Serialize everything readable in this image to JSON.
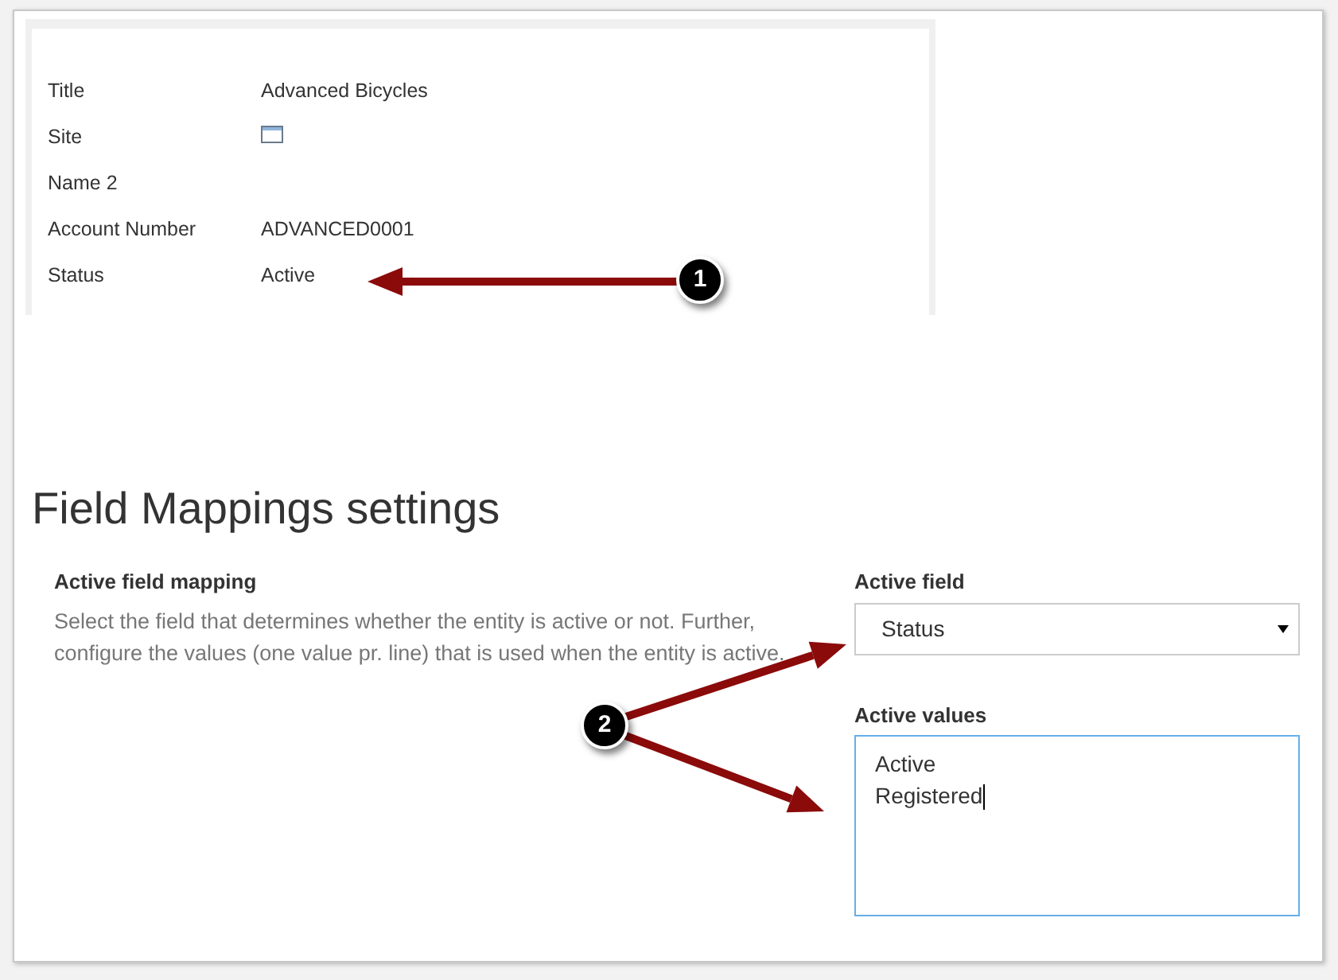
{
  "record": {
    "fields": [
      {
        "label": "Title",
        "kind": "text",
        "value": "Advanced Bicycles"
      },
      {
        "label": "Site",
        "kind": "icon"
      },
      {
        "label": "Name 2",
        "kind": "text"
      },
      {
        "label": "Account Number",
        "kind": "text",
        "value": "ADVANCED0001"
      },
      {
        "label": "Status",
        "kind": "text",
        "value": "Active"
      }
    ]
  },
  "settings": {
    "heading": "Field Mappings settings",
    "section_title": "Active field mapping",
    "description": "Select the field that determines whether the entity is active or not. Further, configure the values (one value pr. line) that is used when the entity is active.",
    "active_field": {
      "label": "Active field",
      "value": "Status"
    },
    "active_values": {
      "label": "Active values",
      "lines": [
        "Active",
        "Registered"
      ],
      "focused": true
    }
  },
  "callouts": [
    "1",
    "2"
  ]
}
